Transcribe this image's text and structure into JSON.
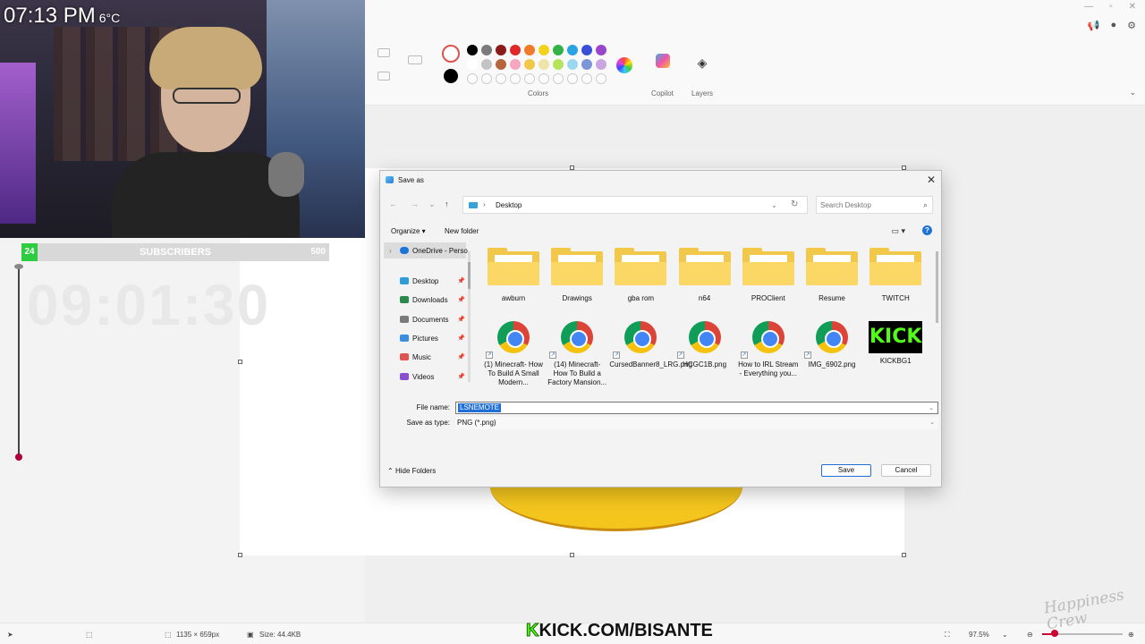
{
  "stream": {
    "clock": "07:13 PM",
    "temperature": "6°C",
    "subscribers": {
      "current": "24",
      "label": "SUBSCRIBERS",
      "goal": "500"
    },
    "timer": "09:01:30",
    "kick_url": "KICK.COM/BISANTE",
    "watermark": "Happiness Crew"
  },
  "paint": {
    "ribbon_labels": {
      "colors": "Colors",
      "copilot": "Copilot",
      "layers": "Layers"
    },
    "status": {
      "dimensions": "1135 × 659px",
      "size": "Size: 44.4KB",
      "zoom": "97.5%"
    },
    "colors": {
      "accent_ring": "#d9534f",
      "row1": [
        "#000000",
        "#7a7a7a",
        "#8b1a1a",
        "#e02828",
        "#f07a2a",
        "#f2d21a",
        "#33b24a",
        "#2aa3e0",
        "#3a4fd8",
        "#9b45c8"
      ],
      "row2": [
        "#ffffff",
        "#c3c3c3",
        "#b5653a",
        "#f5a6c0",
        "#f2c84b",
        "#eee3a8",
        "#b5e35a",
        "#9ad8f0",
        "#7b95d8",
        "#c9a6e0"
      ]
    }
  },
  "dialog": {
    "title": "Save as",
    "address": {
      "location": "Desktop"
    },
    "search": {
      "placeholder": "Search Desktop"
    },
    "commands": {
      "organize": "Organize ▾",
      "new_folder": "New folder"
    },
    "nav_pane": {
      "onedrive": "OneDrive - Perso",
      "items": [
        {
          "label": "Desktop",
          "color": "#2f9bd8"
        },
        {
          "label": "Downloads",
          "color": "#2a8a4a"
        },
        {
          "label": "Documents",
          "color": "#7a7a7a"
        },
        {
          "label": "Pictures",
          "color": "#3a8ee0"
        },
        {
          "label": "Music",
          "color": "#e0534f"
        },
        {
          "label": "Videos",
          "color": "#8a4fd0"
        }
      ]
    },
    "folders": [
      {
        "name": "awburn"
      },
      {
        "name": "Drawings"
      },
      {
        "name": "gba rom"
      },
      {
        "name": "n64"
      },
      {
        "name": "PROClient"
      },
      {
        "name": "Resume"
      },
      {
        "name": "TWITCH"
      }
    ],
    "files": [
      {
        "name": "(1) Minecraft- How To Build A Small Modern..."
      },
      {
        "name": "(14) Minecraft- How To Build a Factory Mansion..."
      },
      {
        "name": "CursedBanner8_LRG.png"
      },
      {
        "name": "HCGC1B.png"
      },
      {
        "name": "How to IRL Stream - Everything you..."
      },
      {
        "name": "IMG_6902.png"
      },
      {
        "name": "KICKBG1",
        "thumb_text": "KICK"
      }
    ],
    "file_name_label": "File name:",
    "file_name_value": "LSNEMOTE",
    "save_type_label": "Save as type:",
    "save_type_value": "PNG (*.png)",
    "hide_folders": "Hide Folders",
    "save_button": "Save",
    "cancel_button": "Cancel"
  }
}
